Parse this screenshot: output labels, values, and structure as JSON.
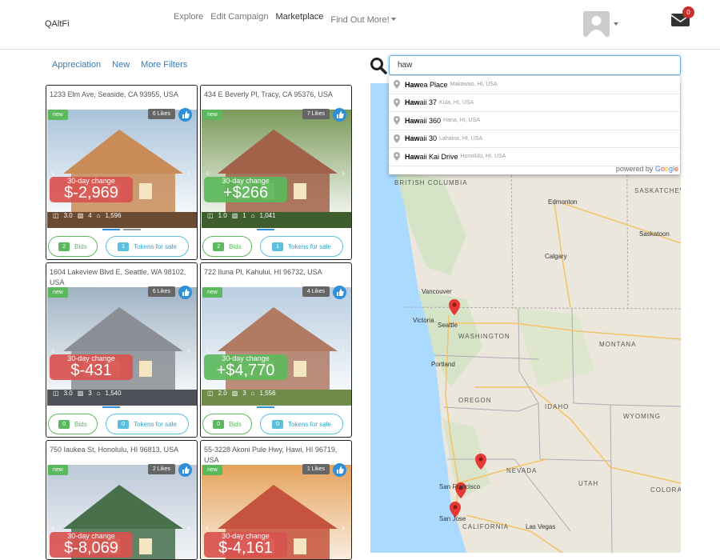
{
  "navbar": {
    "brand": "QAltFi",
    "links": [
      {
        "label": "Explore"
      },
      {
        "label": "Edit Campaign"
      },
      {
        "label": "Marketplace"
      },
      {
        "label": "Find Out More!"
      }
    ],
    "message_count": "0"
  },
  "filters": [
    "Appreciation",
    "New",
    "More Filters"
  ],
  "search": {
    "value": "haw"
  },
  "autocomplete": [
    {
      "main": "Hawea Place",
      "sub": "Makawao, HI, USA"
    },
    {
      "main": "Hawaii 37",
      "sub": "Kula, HI, USA"
    },
    {
      "main": "Hawaii 360",
      "sub": "Hana, HI, USA"
    },
    {
      "main": "Hawaii 30",
      "sub": "Lahaina, HI, USA"
    },
    {
      "main": "Hawaii Kai Drive",
      "sub": "Honolulu, HI, USA"
    }
  ],
  "powered_by": "powered by",
  "listings": [
    {
      "address": "1233 Elm Ave, Seaside, CA 93955, USA",
      "badge": "new",
      "likes": "6 Likes",
      "change_label": "30-day change",
      "change": "$-2,969",
      "trend": "negative",
      "beds": "3.0",
      "baths": "4",
      "sqft": "1,596",
      "bids_count": "2",
      "bids_label": "Bids",
      "tokens_count": "1",
      "tokens_label": "Tokens for sale",
      "color": "#d9534f"
    },
    {
      "address": "434 E Beverly Pl, Tracy, CA 95376, USA",
      "badge": "new",
      "likes": "7 Likes",
      "change_label": "30-day change",
      "change": "+$266",
      "trend": "positive",
      "beds": "1.0",
      "baths": "1",
      "sqft": "1,041",
      "bids_count": "2",
      "bids_label": "Bids",
      "tokens_count": "1",
      "tokens_label": "Tokens for sale",
      "color": "#5cb85c"
    },
    {
      "address": "1604 Lakeview Blvd E, Seattle, WA 98102, USA",
      "badge": "new",
      "likes": "6 Likes",
      "change_label": "30-day change",
      "change": "$-431",
      "trend": "negative",
      "beds": "3.0",
      "baths": "3",
      "sqft": "1,540",
      "bids_count": "0",
      "bids_label": "Bids",
      "tokens_count": "0",
      "tokens_label": "Tokens for sale",
      "color": "#d9534f"
    },
    {
      "address": "722 Iluna Pl, Kahului, HI 96732, USA",
      "badge": "new",
      "likes": "4 Likes",
      "change_label": "30-day change",
      "change": "+$4,770",
      "trend": "positive",
      "beds": "2.0",
      "baths": "3",
      "sqft": "1,556",
      "bids_count": "0",
      "bids_label": "Bids",
      "tokens_count": "0",
      "tokens_label": "Tokens for sale",
      "color": "#5cb85c"
    },
    {
      "address": "750 Iaukea St, Honolulu, HI 96813, USA",
      "badge": "new",
      "likes": "2 Likes",
      "change_label": "30-day change",
      "change": "$-8,069",
      "trend": "negative",
      "color": "#d9534f"
    },
    {
      "address": "55-3228 Akoni Pule Hwy, Hawi, HI 96719, USA",
      "badge": "new",
      "likes": "1 Likes",
      "change_label": "30-day change",
      "change": "$-4,161",
      "trend": "negative",
      "color": "#d9534f"
    }
  ],
  "map": {
    "cities": [
      "Edmonton",
      "Saskatoon",
      "Calgary",
      "Vancouver",
      "Victoria",
      "Seattle",
      "Portland",
      "San Francisco",
      "San Jose",
      "Las Vegas"
    ],
    "states": [
      "BRITISH COLUMBIA",
      "SASKATCHEW",
      "WASHINGTON",
      "MONTANA",
      "OREGON",
      "IDAHO",
      "WYOMING",
      "NEVADA",
      "UTAH",
      "COLORADO",
      "CALIFORNIA"
    ]
  }
}
